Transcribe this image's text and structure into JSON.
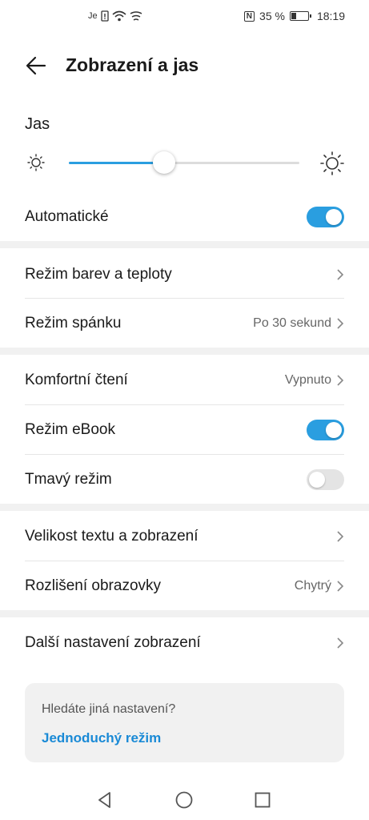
{
  "status_bar": {
    "carrier_icons": "Je",
    "nfc_icon": "N",
    "battery_percent": "35 %",
    "battery_level": 0.35,
    "time": "18:19"
  },
  "header": {
    "title": "Zobrazení a jas"
  },
  "brightness": {
    "label": "Jas",
    "level": 0.38
  },
  "auto": {
    "label": "Automatické",
    "enabled": true
  },
  "group1": [
    {
      "label": "Režim barev a teploty",
      "value": ""
    },
    {
      "label": "Režim spánku",
      "value": "Po 30 sekund"
    }
  ],
  "group2": {
    "comfort": {
      "label": "Komfortní čtení",
      "value": "Vypnuto"
    },
    "ebook": {
      "label": "Režim eBook",
      "enabled": true
    },
    "dark": {
      "label": "Tmavý režim",
      "enabled": false
    }
  },
  "group3": [
    {
      "label": "Velikost textu a zobrazení",
      "value": ""
    },
    {
      "label": "Rozlišení obrazovky",
      "value": "Chytrý"
    }
  ],
  "group4": [
    {
      "label": "Další nastavení zobrazení",
      "value": ""
    }
  ],
  "suggestion": {
    "question": "Hledáte jiná nastavení?",
    "link": "Jednoduchý režim"
  },
  "colors": {
    "accent": "#2a9ee0",
    "link": "#1a8ad6",
    "band": "#f1f1f1"
  }
}
